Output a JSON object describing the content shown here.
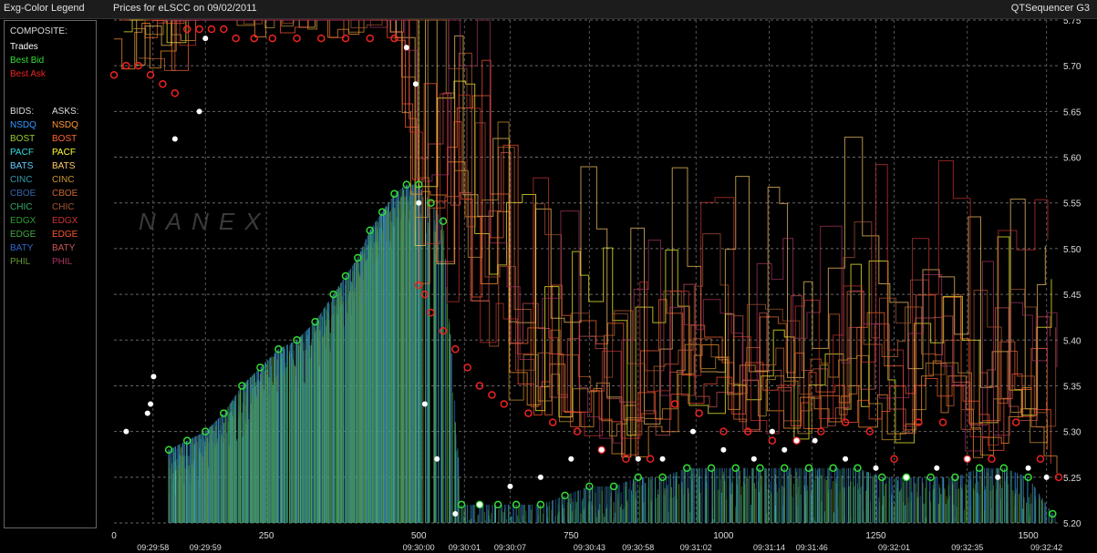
{
  "header": {
    "legend_title": "Exg-Color Legend",
    "chart_title": "Prices for  eLSCC  on  09/02/2011",
    "app_name": "QTSequencer G3"
  },
  "legend": {
    "composite_label": "COMPOSITE:",
    "composite": [
      {
        "label": "Trades",
        "color": "#ffffff"
      },
      {
        "label": "Best Bid",
        "color": "#33dd33"
      },
      {
        "label": "Best Ask",
        "color": "#ee2222"
      }
    ],
    "bids_label": "BIDS:",
    "asks_label": "ASKS:",
    "exchanges": [
      {
        "bid": "NSDQ",
        "ask": "NSDQ",
        "bid_color": "#3399ff",
        "ask_color": "#ff9933"
      },
      {
        "bid": "BOST",
        "ask": "BOST",
        "bid_color": "#99cc33",
        "ask_color": "#ff6633"
      },
      {
        "bid": "PACF",
        "ask": "PACF",
        "bid_color": "#33dddd",
        "ask_color": "#ffff33"
      },
      {
        "bid": "BATS",
        "ask": "BATS",
        "bid_color": "#66ccff",
        "ask_color": "#ffcc66"
      },
      {
        "bid": "CINC",
        "ask": "CINC",
        "bid_color": "#3399aa",
        "ask_color": "#cc9933"
      },
      {
        "bid": "CBOE",
        "ask": "CBOE",
        "bid_color": "#3366aa",
        "ask_color": "#cc6633"
      },
      {
        "bid": "CHIC",
        "ask": "CHIC",
        "bid_color": "#33aa66",
        "ask_color": "#aa5533"
      },
      {
        "bid": "EDGX",
        "ask": "EDGX",
        "bid_color": "#339933",
        "ask_color": "#cc3333"
      },
      {
        "bid": "EDGE",
        "ask": "EDGE",
        "bid_color": "#44aa44",
        "ask_color": "#ff5533"
      },
      {
        "bid": "BATY",
        "ask": "BATY",
        "bid_color": "#3366cc",
        "ask_color": "#cc5555"
      },
      {
        "bid": "PHIL",
        "ask": "PHIL",
        "bid_color": "#669933",
        "ask_color": "#aa3366"
      }
    ]
  },
  "watermark": "NANEX",
  "chart_data": {
    "type": "line",
    "title": "Prices for  eLSCC  on  09/02/2011",
    "ylim": [
      5.2,
      5.75
    ],
    "xlim": [
      0,
      1550
    ],
    "y_ticks": [
      "5.20",
      "5.25",
      "5.30",
      "5.35",
      "5.40",
      "5.45",
      "5.50",
      "5.55",
      "5.60",
      "5.65",
      "5.70",
      "5.75"
    ],
    "x_ticks": [
      "0",
      "250",
      "500",
      "750",
      "1000",
      "1250",
      "1500"
    ],
    "x_tick_values": [
      0,
      250,
      500,
      750,
      1000,
      1250,
      1500
    ],
    "time_labels": [
      "09:29:58",
      "09:29:59",
      "09:30:00",
      "09:30:01",
      "09:30:07",
      "09:30:43",
      "09:30:58",
      "09:31:02",
      "09:31:14",
      "09:31:46",
      "09:32:01",
      "09:32:35",
      "09:32:42"
    ],
    "time_label_x": [
      64,
      150,
      500,
      575,
      650,
      780,
      860,
      955,
      1075,
      1145,
      1280,
      1400,
      1530
    ],
    "series": [
      {
        "name": "Best Bid",
        "color": "#33dd33",
        "x": [
          90,
          120,
          150,
          180,
          210,
          240,
          270,
          300,
          330,
          360,
          380,
          400,
          420,
          440,
          460,
          480,
          500,
          520,
          540,
          570,
          600,
          630,
          660,
          700,
          740,
          780,
          820,
          860,
          900,
          940,
          980,
          1020,
          1060,
          1100,
          1140,
          1180,
          1220,
          1260,
          1300,
          1340,
          1380,
          1420,
          1460,
          1500,
          1540
        ],
        "values": [
          5.28,
          5.29,
          5.3,
          5.32,
          5.35,
          5.37,
          5.39,
          5.4,
          5.42,
          5.45,
          5.47,
          5.49,
          5.52,
          5.54,
          5.56,
          5.57,
          5.57,
          5.55,
          5.53,
          5.22,
          5.22,
          5.22,
          5.22,
          5.22,
          5.23,
          5.24,
          5.24,
          5.25,
          5.25,
          5.26,
          5.26,
          5.26,
          5.26,
          5.26,
          5.26,
          5.26,
          5.26,
          5.25,
          5.25,
          5.25,
          5.25,
          5.26,
          5.26,
          5.25,
          5.21
        ]
      },
      {
        "name": "Best Ask",
        "color": "#ee2222",
        "x": [
          0,
          20,
          40,
          60,
          80,
          100,
          120,
          140,
          160,
          180,
          200,
          230,
          260,
          300,
          340,
          380,
          420,
          460,
          500,
          510,
          520,
          540,
          560,
          580,
          600,
          620,
          640,
          680,
          720,
          760,
          800,
          840,
          880,
          920,
          960,
          1000,
          1040,
          1080,
          1120,
          1160,
          1200,
          1240,
          1280,
          1320,
          1360,
          1400,
          1440,
          1480,
          1520,
          1550
        ],
        "values": [
          5.69,
          5.7,
          5.7,
          5.69,
          5.68,
          5.67,
          5.74,
          5.74,
          5.74,
          5.74,
          5.73,
          5.73,
          5.73,
          5.73,
          5.73,
          5.73,
          5.73,
          5.73,
          5.46,
          5.45,
          5.43,
          5.41,
          5.39,
          5.37,
          5.35,
          5.34,
          5.33,
          5.32,
          5.31,
          5.3,
          5.28,
          5.27,
          5.27,
          5.33,
          5.32,
          5.3,
          5.3,
          5.29,
          5.29,
          5.3,
          5.31,
          5.3,
          5.27,
          5.31,
          5.31,
          5.27,
          5.27,
          5.31,
          5.27,
          5.25
        ]
      },
      {
        "name": "Trades",
        "color": "#ffffff",
        "x": [
          20,
          55,
          60,
          65,
          100,
          140,
          150,
          480,
          495,
          500,
          510,
          530,
          560,
          600,
          650,
          700,
          750,
          800,
          860,
          900,
          950,
          1000,
          1050,
          1080,
          1100,
          1120,
          1150,
          1200,
          1250,
          1300,
          1350,
          1400,
          1450,
          1500,
          1530
        ],
        "values": [
          5.3,
          5.32,
          5.33,
          5.36,
          5.62,
          5.65,
          5.73,
          5.72,
          5.68,
          5.55,
          5.33,
          5.27,
          5.21,
          5.22,
          5.24,
          5.25,
          5.27,
          5.28,
          5.27,
          5.27,
          5.3,
          5.28,
          5.27,
          5.3,
          5.28,
          5.29,
          5.29,
          5.27,
          5.26,
          5.25,
          5.26,
          5.27,
          5.25,
          5.26,
          5.25
        ]
      }
    ]
  }
}
